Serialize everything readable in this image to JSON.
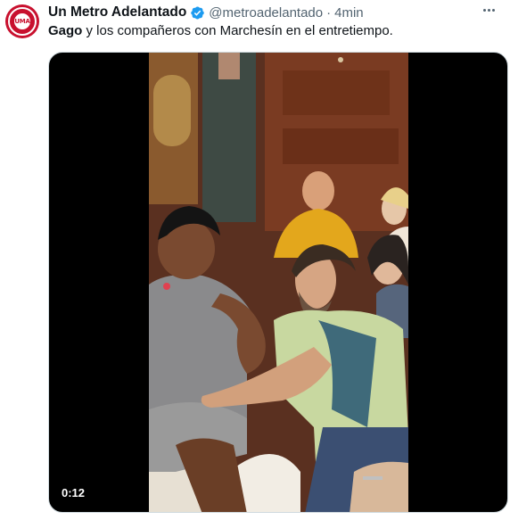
{
  "tweet": {
    "display_name": "Un Metro Adelantado",
    "verified": true,
    "handle": "@metroadelantado",
    "separator": "·",
    "time": "4min",
    "text_bold": "Gago",
    "text_rest": " y los compañeros con Marchesín en el entretiempo.",
    "avatar": {
      "logo_text": "UMA",
      "brand_color": "#c8102e"
    }
  },
  "video": {
    "duration": "0:12"
  },
  "colors": {
    "text": "#0f1419",
    "secondary": "#536471",
    "verified_badge": "#1d9bf0",
    "video_background": "#000000"
  },
  "icons": {
    "verified": "verified-badge-icon",
    "more": "more-icon"
  }
}
